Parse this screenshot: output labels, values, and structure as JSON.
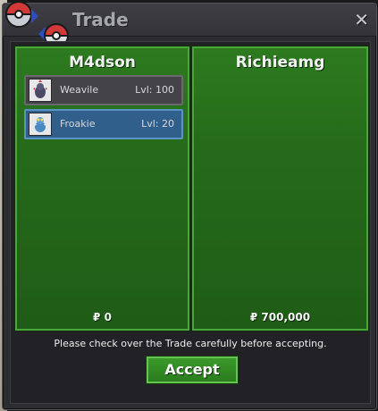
{
  "window": {
    "title": "Trade",
    "close_label": "✕"
  },
  "left_panel": {
    "player": "M4dson",
    "items": [
      {
        "name": "Weavile",
        "level": "Lvl: 100",
        "selected": false
      },
      {
        "name": "Froakie",
        "level": "Lvl: 20",
        "selected": true
      }
    ],
    "money": "₽ 0"
  },
  "right_panel": {
    "player": "Richieamg",
    "money": "₽ 700,000"
  },
  "notice": "Please check over the Trade carefully before accepting.",
  "accept_label": "Accept",
  "colors": {
    "panel_green": "#2d7a1f",
    "selected_blue": "#2f5f8a",
    "accept_green": "#3b9a2a"
  }
}
